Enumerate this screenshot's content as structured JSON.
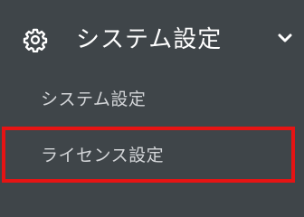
{
  "menu": {
    "header": {
      "label": "システム設定",
      "icon": "gear-icon",
      "toggle_icon": "chevron-down-icon",
      "expanded": true
    },
    "items": [
      {
        "label": "システム設定"
      },
      {
        "label": "ライセンス設定"
      }
    ]
  },
  "colors": {
    "background": "#3f4549",
    "header_text": "#ffffff",
    "item_text": "#d3d5d8",
    "highlight_border": "#e61414"
  }
}
